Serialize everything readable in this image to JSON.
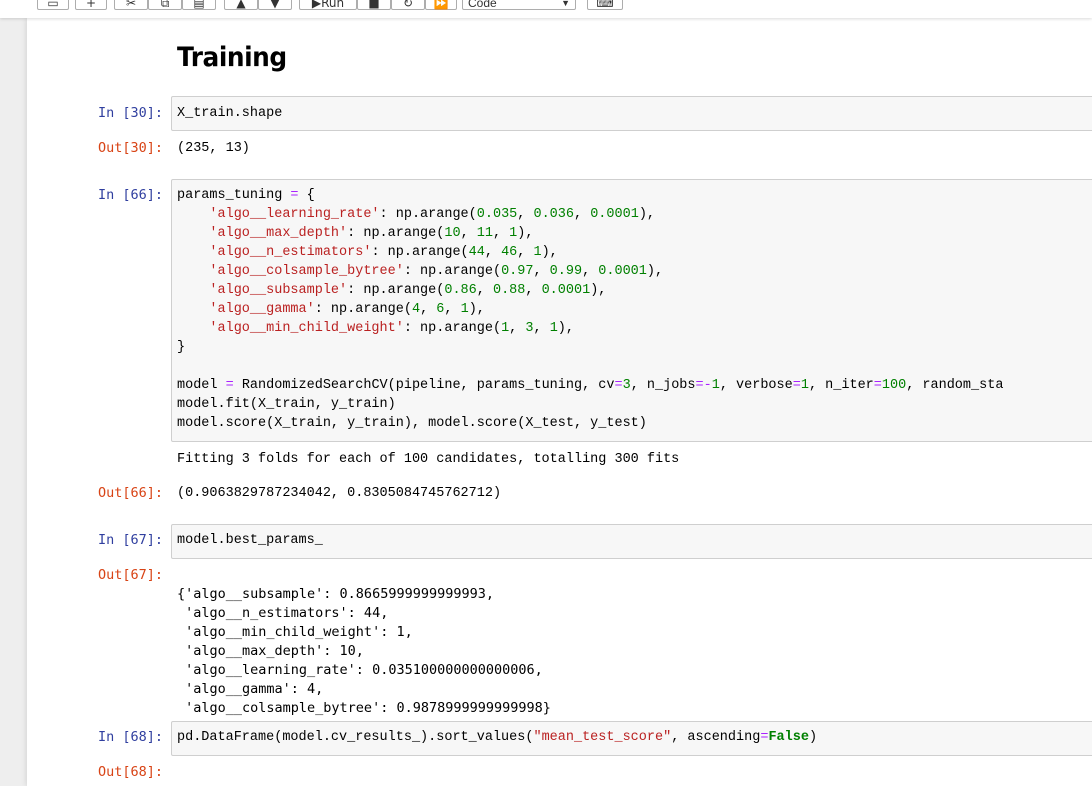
{
  "toolbar": {
    "run_label": "Run",
    "cell_type": "Code"
  },
  "heading": "Training",
  "cells": [
    {
      "in_prompt": "In [30]:",
      "code": "X_train.shape",
      "out_prompt": "Out[30]:",
      "output": "(235, 13)"
    },
    {
      "in_prompt": "In [66]:",
      "code_lines": [
        "params_tuning = {",
        "    'algo__learning_rate': np.arange(0.035, 0.036, 0.0001),",
        "    'algo__max_depth': np.arange(10, 11, 1),",
        "    'algo__n_estimators': np.arange(44, 46, 1),",
        "    'algo__colsample_bytree': np.arange(0.97, 0.99, 0.0001),",
        "    'algo__subsample': np.arange(0.86, 0.88, 0.0001),",
        "    'algo__gamma': np.arange(4, 6, 1),",
        "    'algo__min_child_weight': np.arange(1, 3, 1),",
        "}",
        "",
        "model = RandomizedSearchCV(pipeline, params_tuning, cv=3, n_jobs=-1, verbose=1, n_iter=100, random_sta",
        "model.fit(X_train, y_train)",
        "model.score(X_train, y_train), model.score(X_test, y_test)"
      ],
      "stream_output": "Fitting 3 folds for each of 100 candidates, totalling 300 fits",
      "out_prompt": "Out[66]:",
      "output": "(0.9063829787234042, 0.8305084745762712)"
    },
    {
      "in_prompt": "In [67]:",
      "code": "model.best_params_",
      "out_prompt": "Out[67]:",
      "output_lines": [
        "{'algo__subsample': 0.8665999999999993,",
        " 'algo__n_estimators': 44,",
        " 'algo__min_child_weight': 1,",
        " 'algo__max_depth': 10,",
        " 'algo__learning_rate': 0.035100000000000006,",
        " 'algo__gamma': 4,",
        " 'algo__colsample_bytree': 0.9878999999999998}"
      ]
    },
    {
      "in_prompt": "In [68]:",
      "code_parts": [
        "pd.DataFrame(model.cv_results_).sort_values(",
        "\"mean_test_score\"",
        ", ascending",
        "=",
        "False",
        ")"
      ],
      "out_prompt": "Out[68]:"
    }
  ]
}
